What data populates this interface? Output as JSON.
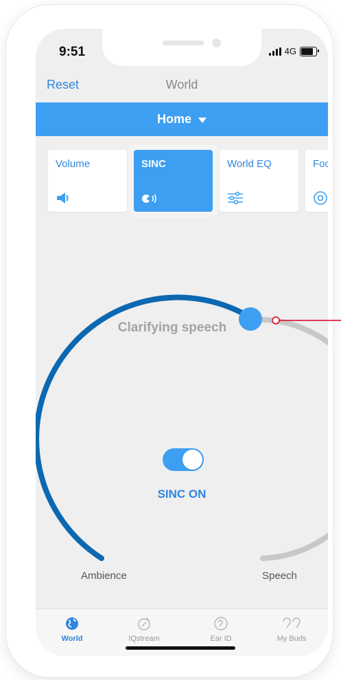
{
  "status": {
    "time": "9:51",
    "network": "4G"
  },
  "nav": {
    "reset_label": "Reset",
    "title": "World"
  },
  "preset": {
    "label": "Home"
  },
  "tiles": [
    {
      "label": "Volume",
      "icon": "speaker-icon",
      "active": false
    },
    {
      "label": "SINC",
      "icon": "sinc-icon",
      "active": true
    },
    {
      "label": "World EQ",
      "icon": "equalizer-icon",
      "active": false
    },
    {
      "label": "Foc",
      "icon": "focus-icon",
      "active": false
    }
  ],
  "sinc": {
    "mode_text": "Clarifying speech",
    "toggle_label": "SINC ON",
    "toggle_on": true,
    "left_label": "Ambience",
    "right_label": "Speech"
  },
  "tabs": [
    {
      "label": "World",
      "icon": "globe-icon",
      "active": true
    },
    {
      "label": "IQstream",
      "icon": "iqstream-icon",
      "active": false
    },
    {
      "label": "Ear ID",
      "icon": "ear-icon",
      "active": false
    },
    {
      "label": "My Buds",
      "icon": "earbuds-icon",
      "active": false
    }
  ],
  "colors": {
    "accent": "#3d9ff2",
    "arc_active": "#0b68b1",
    "arc_inactive": "#c8c8c8",
    "callout": "#d0021b"
  }
}
